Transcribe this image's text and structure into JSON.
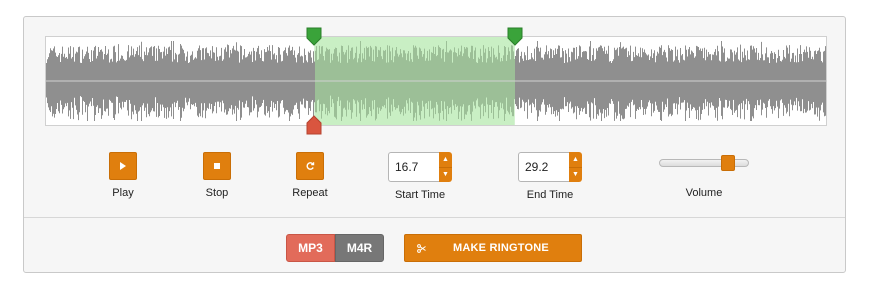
{
  "waveform": {
    "selection_start_fraction": 0.344,
    "selection_end_fraction": 0.601,
    "colors": {
      "wave": "#8f8f8f",
      "selection_fill": "#c9efc4",
      "selection_wave": "#9cbf97",
      "start_marker": "#3aa33a",
      "end_marker": "#3aa33a",
      "playhead_marker": "#d9553f"
    }
  },
  "controls": {
    "play": {
      "label": "Play",
      "icon": "play-icon"
    },
    "stop": {
      "label": "Stop",
      "icon": "stop-icon"
    },
    "repeat": {
      "label": "Repeat",
      "icon": "repeat-icon"
    },
    "start_time": {
      "label": "Start Time",
      "value": "16.7"
    },
    "end_time": {
      "label": "End Time",
      "value": "29.2"
    },
    "volume": {
      "label": "Volume",
      "level": 0.82
    }
  },
  "bottom_bar": {
    "formats": [
      {
        "label": "MP3",
        "selected": true
      },
      {
        "label": "M4R",
        "selected": false
      }
    ],
    "make_button": {
      "label": "MAKE RINGTONE",
      "icon": "scissors-icon"
    }
  },
  "accent_color": "#e07f0e"
}
